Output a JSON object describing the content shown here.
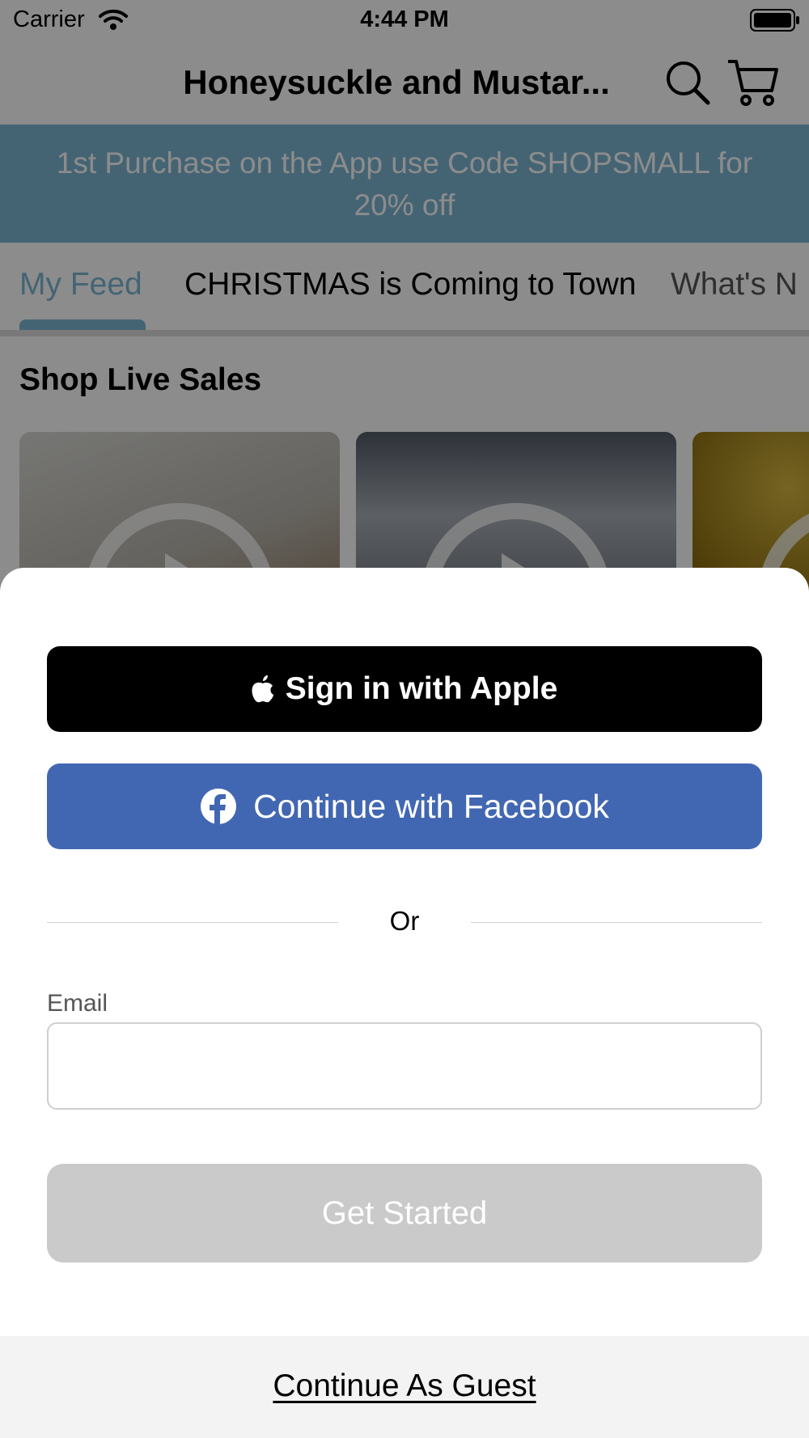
{
  "status_bar": {
    "carrier": "Carrier",
    "time": "4:44 PM",
    "icons": [
      "wifi-icon",
      "battery-icon"
    ]
  },
  "nav": {
    "title": "Honeysuckle and Mustar...",
    "icons": [
      "search-icon",
      "cart-icon"
    ]
  },
  "promo": {
    "text": "1st Purchase on the App use Code SHOPSMALL for 20% off"
  },
  "tabs": [
    {
      "label": "My Feed",
      "active": true
    },
    {
      "label": "CHRISTMAS is Coming to Town",
      "active": false
    },
    {
      "label": "What's N",
      "active": false
    }
  ],
  "feed": {
    "section_title": "Shop Live Sales",
    "cards": [
      {
        "icon": "play-icon"
      },
      {
        "icon": "play-icon"
      },
      {
        "icon": "play-icon"
      }
    ]
  },
  "sheet": {
    "apple_button_label": "Sign in with Apple",
    "facebook_button_label": "Continue with Facebook",
    "or_text": "Or",
    "email_label": "Email",
    "email_value": "",
    "email_placeholder": "",
    "get_started_label": "Get Started",
    "guest_link": "Continue As Guest"
  },
  "colors": {
    "accent": "#7cb7d3",
    "facebook_blue": "#4267b2",
    "apple_black": "#000000",
    "disabled_gray": "#cacaca"
  }
}
